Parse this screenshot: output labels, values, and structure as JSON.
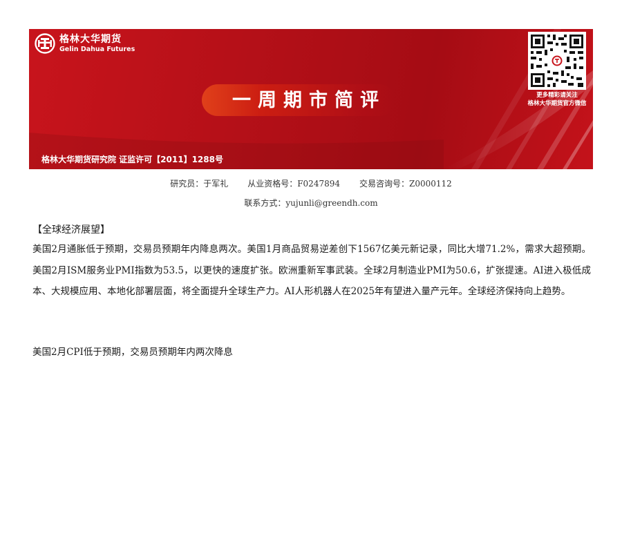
{
  "header": {
    "brand_cn": "格林大华期货",
    "brand_en": "Gelin Dahua Futures",
    "title": "一周期市简评",
    "qr_caption_line1": "更多精彩请关注",
    "qr_caption_line2": "格林大华期货官方微信",
    "footer": "格林大华期货研究院  证监许可【2011】1288号",
    "colors": {
      "banner_red": "#b10f17",
      "pill_orange": "#e0401a"
    }
  },
  "researcher": {
    "analyst": "研究员：于军礼",
    "qualification": "从业资格号：F0247894",
    "consulting": "交易咨询号：Z0000112",
    "contact": "联系方式：yujunli@greendh.com"
  },
  "content": {
    "section_title": "【全球经济展望】",
    "paragraph": "美国2月通胀低于预期，交易员预期年内降息两次。美国1月商品贸易逆差创下1567亿美元新记录，同比大增71.2%，需求大超预期。美国2月ISM服务业PMI指数为53.5，以更快的速度扩张。欧洲重新军事武装。全球2月制造业PMI为50.6，扩张提速。AI进入极低成本、大规模应用、本地化部署层面，将全面提升全球生产力。AI人形机器人在2025年有望进入量产元年。全球经济保持向上趋势。",
    "subheading": "美国2月CPI低于预期，交易员预期年内两次降息"
  },
  "icons": {
    "logo": "gelin-dahua-logo-icon",
    "qr": "wechat-qr-code-icon"
  }
}
